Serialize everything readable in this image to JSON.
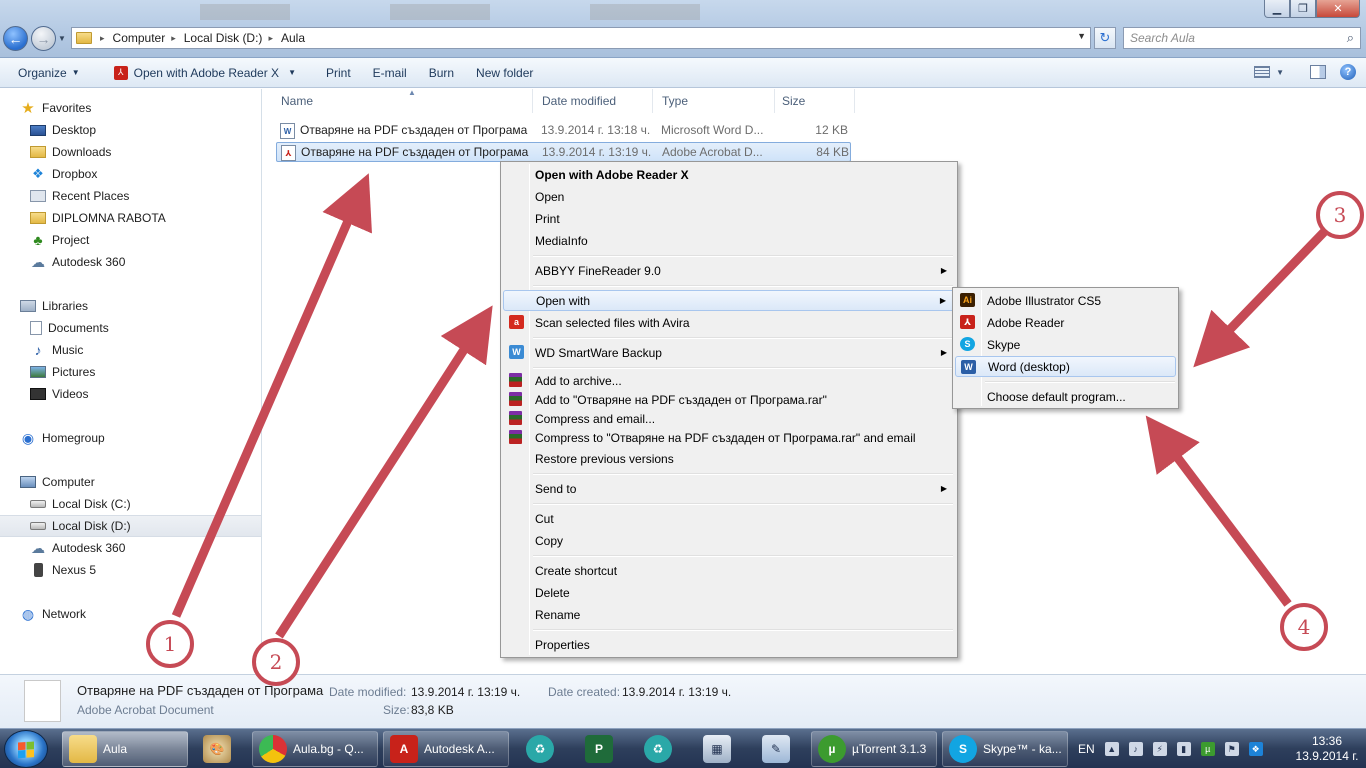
{
  "address": {
    "crumbs": [
      "Computer",
      "Local Disk (D:)",
      "Aula"
    ],
    "search_placeholder": "Search Aula"
  },
  "toolbar": {
    "organize": "Organize",
    "open_with": "Open with Adobe Reader X",
    "print": "Print",
    "email": "E-mail",
    "burn": "Burn",
    "new_folder": "New folder"
  },
  "nav": {
    "favorites": "Favorites",
    "desktop": "Desktop",
    "downloads": "Downloads",
    "dropbox": "Dropbox",
    "recent": "Recent Places",
    "diploma": "DIPLOMNA RABOTA",
    "project": "Project",
    "autodesk_fav": "Autodesk 360",
    "libraries": "Libraries",
    "documents": "Documents",
    "music": "Music",
    "pictures": "Pictures",
    "videos": "Videos",
    "homegroup": "Homegroup",
    "computer": "Computer",
    "disk_c": "Local Disk (C:)",
    "disk_d": "Local Disk (D:)",
    "autodesk_comp": "Autodesk 360",
    "nexus": "Nexus 5",
    "network": "Network"
  },
  "columns": {
    "name": "Name",
    "date": "Date modified",
    "type": "Type",
    "size": "Size"
  },
  "files": [
    {
      "name": "Отваряне на PDF създаден от Програма",
      "date": "13.9.2014 г. 13:18 ч.",
      "type": "Microsoft Word D...",
      "size": "12 KB",
      "icon": "word-icon"
    },
    {
      "name": "Отваряне на PDF създаден от Програма",
      "date": "13.9.2014 г. 13:19 ч.",
      "type": "Adobe Acrobat D...",
      "size": "84 KB",
      "icon": "pdf-icon"
    }
  ],
  "context_menu": {
    "open_with_reader": "Open with Adobe Reader X",
    "open": "Open",
    "print": "Print",
    "mediainfo": "MediaInfo",
    "abbyy": "ABBYY FineReader 9.0",
    "open_with": "Open with",
    "avira": "Scan selected files with Avira",
    "wd": "WD SmartWare Backup",
    "add_archive": "Add to archive...",
    "add_rar": "Add to \"Отваряне на PDF създаден от Програма.rar\"",
    "compress_email": "Compress and email...",
    "compress_rar_email": "Compress to \"Отваряне на PDF създаден от Програма.rar\" and email",
    "restore": "Restore previous versions",
    "send_to": "Send to",
    "cut": "Cut",
    "copy": "Copy",
    "create_shortcut": "Create shortcut",
    "delete": "Delete",
    "rename": "Rename",
    "properties": "Properties"
  },
  "submenu": {
    "illustrator": "Adobe Illustrator CS5",
    "reader": "Adobe Reader",
    "skype": "Skype",
    "word": "Word (desktop)",
    "default": "Choose default program..."
  },
  "details": {
    "filename": "Отваряне на PDF създаден от Програма",
    "filetype": "Adobe Acrobat Document",
    "date_modified_label": "Date modified:",
    "date_modified": "13.9.2014 г. 13:19 ч.",
    "date_created_label": "Date created:",
    "date_created": "13.9.2014 г. 13:19 ч.",
    "size_label": "Size:",
    "size": "83,8 KB"
  },
  "taskbar": {
    "aula": "Aula",
    "chrome": "Aula.bg - Q...",
    "autodesk": "Autodesk A...",
    "utorrent": "µTorrent 3.1.3",
    "skype": "Skype™ - ka...",
    "lang": "EN",
    "time": "13:36",
    "date": "13.9.2014 г."
  },
  "annotations": [
    "1",
    "2",
    "3",
    "4"
  ],
  "colors": {
    "annotation": "#c64a55",
    "selection": "#cfe3f9"
  }
}
